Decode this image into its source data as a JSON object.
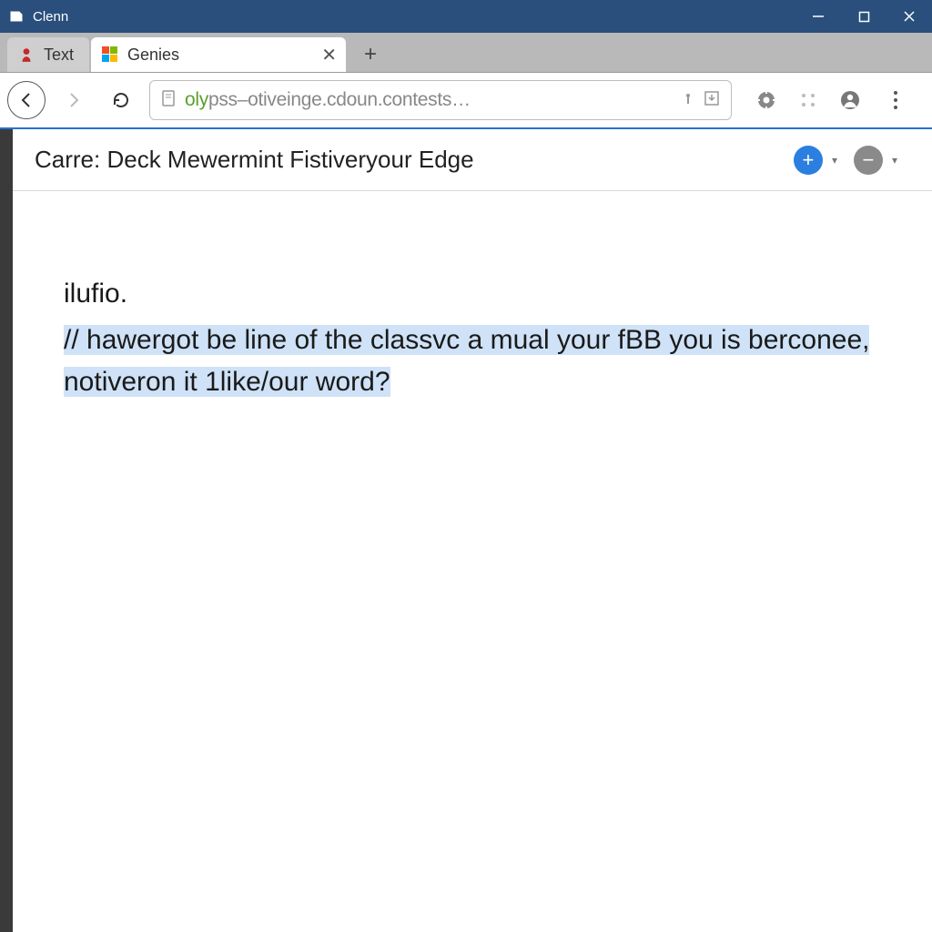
{
  "window": {
    "title": "Clenn"
  },
  "tabs": {
    "inactive_label": "Text",
    "active_label": "Genies"
  },
  "address": {
    "url_scheme_fragment": "oly",
    "url_rest": "pss–otiveinge.cdoun.contests…"
  },
  "page": {
    "title": "Carre: Deck Mewermint Fistiveryour Edge"
  },
  "body": {
    "unselected_line": "ilufio.",
    "selected_line1": "// hawergot be line of the classvc a mual your fBB you is berconee,",
    "selected_line2": "notiveron it 1like/our word?"
  }
}
